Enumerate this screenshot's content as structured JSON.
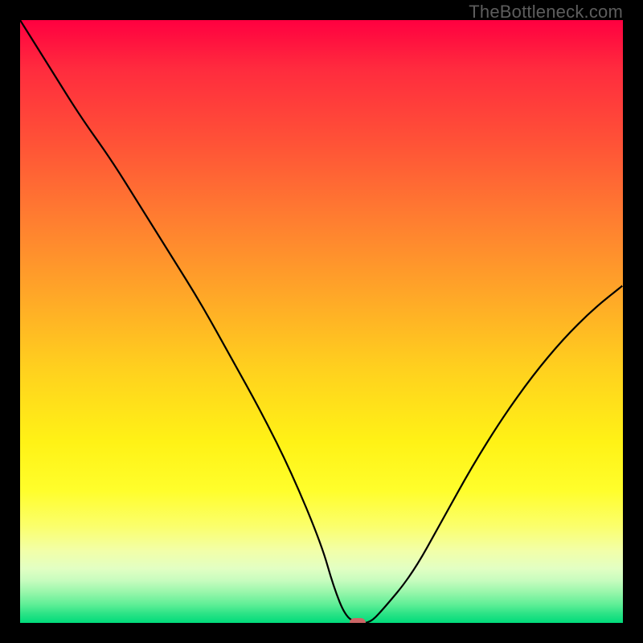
{
  "watermark": "TheBottleneck.com",
  "colors": {
    "background": "#000000",
    "curve_stroke": "#000000",
    "marker": "#cc6666",
    "gradient_top": "#ff0040",
    "gradient_bottom": "#00db7b"
  },
  "chart_data": {
    "type": "line",
    "title": "",
    "xlabel": "",
    "ylabel": "",
    "xlim": [
      0,
      100
    ],
    "ylim": [
      0,
      100
    ],
    "grid": false,
    "legend": false,
    "annotations": [
      "TheBottleneck.com"
    ],
    "series": [
      {
        "name": "bottleneck-curve",
        "x": [
          0,
          5,
          10,
          15,
          20,
          25,
          30,
          35,
          40,
          45,
          50,
          52,
          54,
          56,
          58,
          60,
          65,
          70,
          75,
          80,
          85,
          90,
          95,
          100
        ],
        "y": [
          100,
          92,
          84,
          77,
          69,
          61,
          53,
          44,
          35,
          25,
          13,
          6,
          1,
          0,
          0,
          2,
          8,
          17,
          26,
          34,
          41,
          47,
          52,
          56
        ]
      }
    ],
    "marker": {
      "x": 56,
      "y": 0
    },
    "background_gradient": {
      "type": "vertical",
      "stops": [
        {
          "pos": 0,
          "color": "#ff0040"
        },
        {
          "pos": 0.7,
          "color": "#fff216"
        },
        {
          "pos": 1.0,
          "color": "#00db7b"
        }
      ]
    }
  }
}
